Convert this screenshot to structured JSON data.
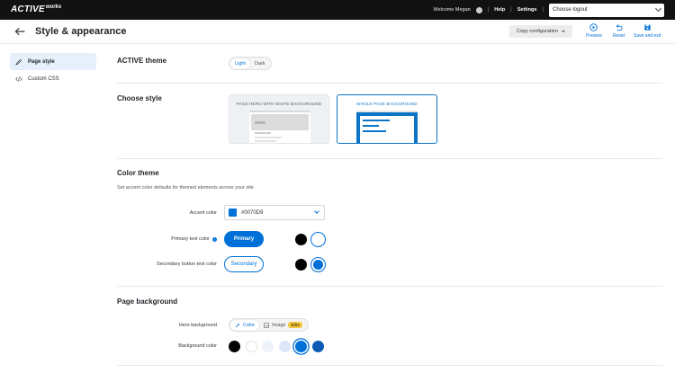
{
  "topbar": {
    "logo_main": "ACTIVE",
    "logo_sub": "works",
    "welcome": "Welcome Megan",
    "help": "Help",
    "settings": "Settings",
    "logout_select": "Choose logout"
  },
  "header": {
    "title": "Style & appearance",
    "copy_config": "Copy configuration",
    "preview": "Preview",
    "reset": "Reset",
    "save_exit": "Save and exit"
  },
  "sidebar": {
    "items": [
      {
        "label": "Page style",
        "icon": "brush-icon",
        "active": true
      },
      {
        "label": "Custom CSS",
        "icon": "code-icon",
        "active": false
      }
    ]
  },
  "active_theme": {
    "title": "ACTIVE theme",
    "options": [
      "Light",
      "Dark"
    ],
    "selected": "Light"
  },
  "choose_style": {
    "title": "Choose style",
    "cards": [
      {
        "label": "PAGE HERO WITH WHITE BACKGROUND",
        "selected": false
      },
      {
        "label": "WHOLE PAGE BACKGROUND",
        "selected": true
      }
    ]
  },
  "color_theme": {
    "title": "Color theme",
    "subtitle": "Set accent color defaults for themed elements across your site",
    "accent_label": "Accent color",
    "accent_value": "#0070D9",
    "accent_color": "#0070D9",
    "primary_label": "Primary text color",
    "primary_button": "Primary",
    "secondary_label": "Secondary button text color",
    "secondary_button": "Secondary"
  },
  "page_background": {
    "title": "Page background",
    "hero_label": "Hero background",
    "hero_options": [
      "Color",
      "Image"
    ],
    "hero_selected": "Color",
    "elite_badge": "Elite",
    "bg_label": "Background color",
    "bg_swatches": [
      "#000000",
      "#ffffff",
      "#eef3fb",
      "#dbe7f7",
      "#0070D9",
      "#0b5bb5"
    ],
    "bg_selected_index": 4
  }
}
